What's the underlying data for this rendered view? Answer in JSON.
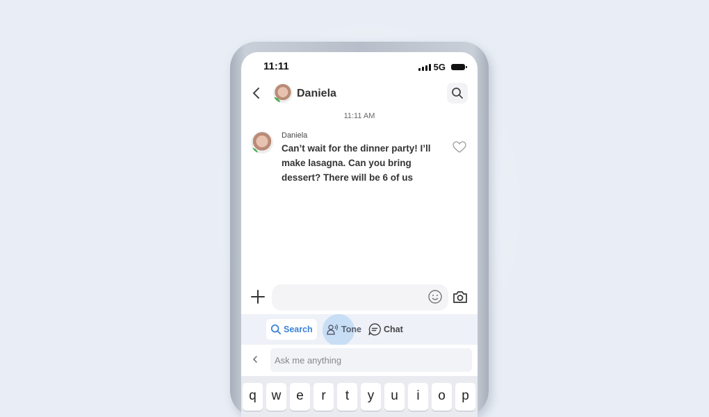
{
  "status_bar": {
    "time": "11:11",
    "network": "5G"
  },
  "header": {
    "contact_name": "Daniela"
  },
  "conversation": {
    "timestamp": "11:11 AM",
    "messages": [
      {
        "sender": "Daniela",
        "text": "Can’t wait for the dinner party! I’ll make lasagna. Can you bring dessert? There will be 6 of us"
      }
    ]
  },
  "composer": {
    "placeholder": ""
  },
  "ai_tools": {
    "chips": [
      {
        "label": "Search",
        "icon": "search-icon",
        "active": true
      },
      {
        "label": "Tone",
        "icon": "tone-icon",
        "highlighted": true
      },
      {
        "label": "Chat",
        "icon": "chat-icon"
      }
    ],
    "ask_placeholder": "Ask me anything"
  },
  "keyboard": {
    "row1": [
      "q",
      "w",
      "e",
      "r",
      "t",
      "y",
      "u",
      "i",
      "o",
      "p"
    ]
  },
  "colors": {
    "accent": "#3b82d6",
    "highlight": "#c7def5",
    "background": "#e9eef6"
  }
}
